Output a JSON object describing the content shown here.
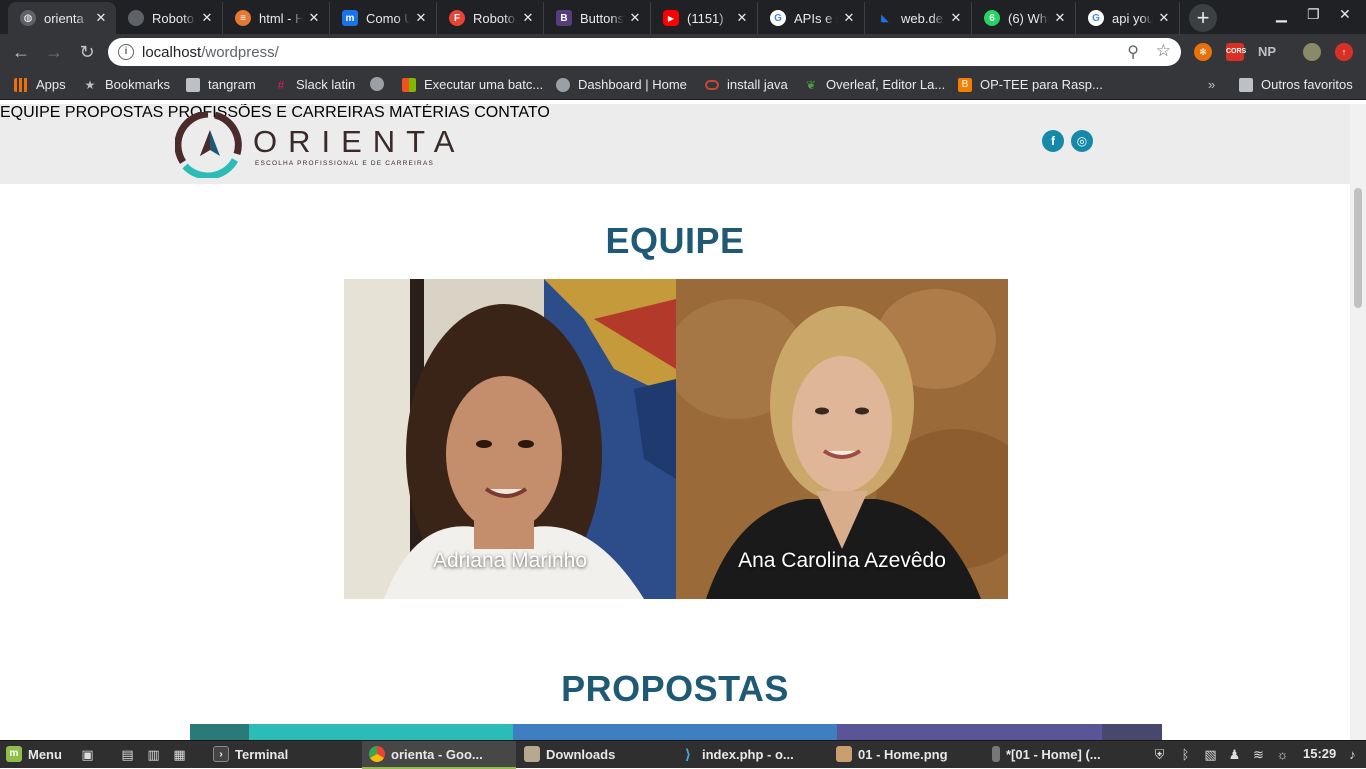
{
  "browser": {
    "tabs": [
      {
        "title": "orienta",
        "active": true,
        "favicon_color": "#5f6368",
        "favicon_glyph": ""
      },
      {
        "title": "Roboto",
        "active": false,
        "favicon_color": "#5f6368",
        "favicon_glyph": ""
      },
      {
        "title": "html - H",
        "active": false,
        "favicon_color": "#e37933",
        "favicon_glyph": "≡"
      },
      {
        "title": "Como U",
        "active": false,
        "favicon_color": "#1a73e8",
        "favicon_glyph": "m"
      },
      {
        "title": "Roboto",
        "active": false,
        "favicon_color": "#ea4335",
        "favicon_glyph": "F"
      },
      {
        "title": "Buttons",
        "active": false,
        "favicon_color": "#563d7c",
        "favicon_glyph": "B"
      },
      {
        "title": "(1151)",
        "active": false,
        "favicon_color": "#ff0000",
        "favicon_glyph": "▶"
      },
      {
        "title": "APIs e s",
        "active": false,
        "favicon_color": "#4285f4",
        "favicon_glyph": "G"
      },
      {
        "title": "web.de",
        "active": false,
        "favicon_color": "#1a73e8",
        "favicon_glyph": "◣"
      },
      {
        "title": "(6) Wha",
        "active": false,
        "favicon_color": "#25d366",
        "favicon_glyph": "6"
      },
      {
        "title": "api yout",
        "active": false,
        "favicon_color": "#4285f4",
        "favicon_glyph": "G"
      }
    ],
    "close_glyph": "✕",
    "new_tab_glyph": "+",
    "url_host": "localhost",
    "url_path": "/wordpress/",
    "bookmarks": [
      {
        "label": "Apps",
        "icon": "apps-grid-icon"
      },
      {
        "label": "Bookmarks",
        "icon": "star-icon"
      },
      {
        "label": "tangram",
        "icon": "folder-icon"
      },
      {
        "label": "Slack latin",
        "icon": "slack-icon"
      },
      {
        "label": "",
        "icon": "globe-icon"
      },
      {
        "label": "Executar uma batc...",
        "icon": "microsoft-icon"
      },
      {
        "label": "Dashboard | Home",
        "icon": "globe-icon"
      },
      {
        "label": "install java",
        "icon": "oracle-icon"
      },
      {
        "label": "Overleaf, Editor La...",
        "icon": "overleaf-icon"
      },
      {
        "label": "OP-TEE para Rasp...",
        "icon": "blogger-icon"
      }
    ],
    "bookmarks_overflow": "»",
    "other_bookmarks": "Outros favoritos",
    "extensions": [
      "NP"
    ]
  },
  "site": {
    "logo_word": "ORIENTA",
    "logo_tagline": "ESCOLHA PROFISSIONAL E DE CARREIRAS",
    "menu": [
      "EQUIPE",
      "PROPOSTAS",
      "PROFISSÕES E CARREIRAS",
      "MATÉRIAS",
      "CONTATO"
    ],
    "social": [
      {
        "name": "facebook",
        "glyph": "f"
      },
      {
        "name": "instagram",
        "glyph": "◎"
      }
    ],
    "team_title": "EQUIPE",
    "team": [
      {
        "name": "Adriana Marinho"
      },
      {
        "name": "Ana Carolina Azevêdo"
      }
    ],
    "proposals_title": "PROPOSTAS",
    "proposal_strip_colors": [
      "#2a7a7a",
      "#2cbcb8",
      "#3d7fc1",
      "#5a5596",
      "#48476e"
    ],
    "colors": {
      "heading": "#1e5a76",
      "accent": "#1689a8",
      "header_bg": "#ececec"
    }
  },
  "taskbar": {
    "menu_label": "Menu",
    "items": [
      {
        "label": "Terminal",
        "active": false
      },
      {
        "label": "orienta - Goo...",
        "active": true
      },
      {
        "label": "Downloads",
        "active": false
      },
      {
        "label": "index.php - o...",
        "active": false
      },
      {
        "label": "01 - Home.png",
        "active": false
      },
      {
        "label": "*[01 - Home] (...",
        "active": false
      }
    ],
    "clock": "15:29"
  }
}
